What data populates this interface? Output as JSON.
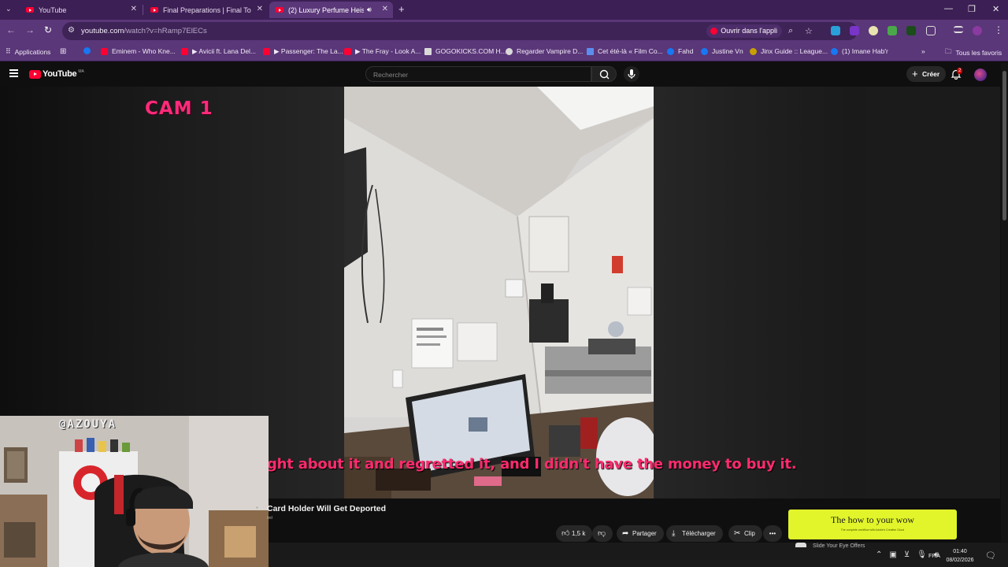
{
  "browser": {
    "tabs": [
      {
        "label": "YouTube",
        "active": false
      },
      {
        "label": "Final Preparations | Final Touch",
        "active": false
      },
      {
        "label": "(2) Luxury Perfume Heist at",
        "active": true
      }
    ],
    "new_tab_symbol": "+",
    "url_host": "youtube.com",
    "url_path": "/watch?v=hRamp7ElECs",
    "open_in_app": "Ouvrir dans l'appli",
    "bookmarks": [
      {
        "label": "Applications",
        "color": "#d9d9d9"
      },
      {
        "label": "",
        "color": "#d9d9d9"
      },
      {
        "label": "",
        "color": "#1877f2"
      },
      {
        "label": "Eminem - Who Kne...",
        "color": "#ff0033"
      },
      {
        "label": "▶ Avicii ft. Lana Del...",
        "color": "#ff0033"
      },
      {
        "label": "▶ Passenger: The La...",
        "color": "#ff0033"
      },
      {
        "label": "▶ The Fray - Look A...",
        "color": "#ff0033"
      },
      {
        "label": "GOGOKICKS.COM H...",
        "color": "#d9d9d9"
      },
      {
        "label": "Regarder Vampire D...",
        "color": "#d9d9d9"
      },
      {
        "label": "Cet été-là « Film Co...",
        "color": "#5b8def"
      },
      {
        "label": "Fahd",
        "color": "#1877f2"
      },
      {
        "label": "Justine Vn",
        "color": "#1877f2"
      },
      {
        "label": "Jinx Guide :: League...",
        "color": "#c8a000"
      },
      {
        "label": "(1) Imane Hab'r",
        "color": "#1877f2"
      }
    ],
    "all_bookmarks": "Tous les favoris"
  },
  "youtube": {
    "logo_text": "YouTube",
    "logo_country": "MA",
    "search_placeholder": "Rechercher",
    "create_label": "Créer",
    "notifications_count": "2"
  },
  "video": {
    "cam_label": "CAM 1",
    "subtitle": "ght about it and regretted it, and I didn't have the money to buy it.",
    "title_visible": "Card Holder Will Get Deported",
    "title_line2": "ted",
    "likes": "1,5 k",
    "share_label": "Partager",
    "download_label": "Télécharger",
    "clip_label": "Clip"
  },
  "webcam": {
    "handle": "@AZOUYA"
  },
  "ad": {
    "headline": "The how to your wow",
    "subtext": "The complete workflow with Adobe's Creative Cloud",
    "below": "Slide Your Eye Offers"
  },
  "taskbar": {
    "language": "FRA",
    "time": "01:40",
    "date": "08/02/2026"
  },
  "colors": {
    "tab_strip": "#3c1f55",
    "toolbar": "#5a3778",
    "yt_red": "#ff0033",
    "subtitle": "#ff2b6e",
    "ad_bg": "#e2f52a"
  }
}
